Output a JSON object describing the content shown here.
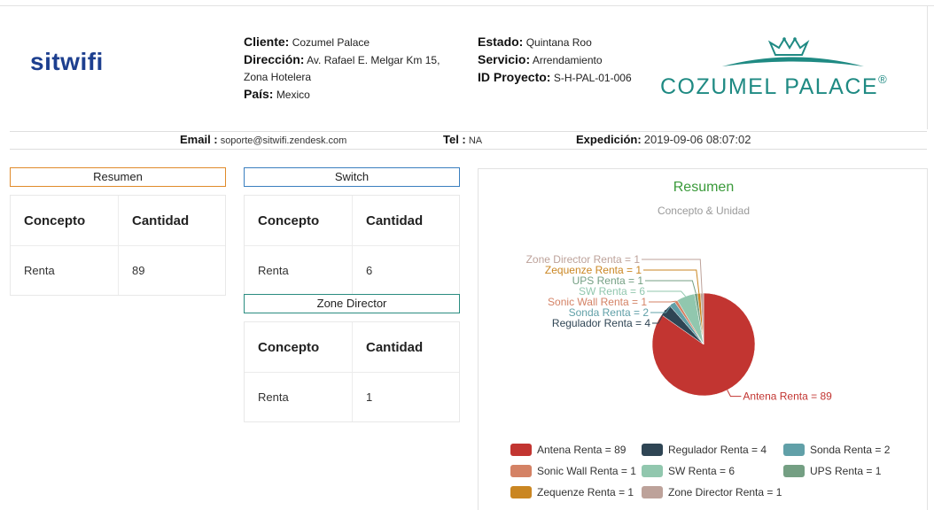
{
  "header": {
    "logo_text": "sitwifi",
    "brand_text": "COZUMEL PALACE",
    "brand_mark": "®",
    "cliente": {
      "label": "Cliente:",
      "value": "Cozumel Palace"
    },
    "direccion": {
      "label": "Dirección:",
      "value_line1": "Av. Rafael E. Melgar Km 15,",
      "value_line2": "Zona Hotelera"
    },
    "pais": {
      "label": "País:",
      "value": "Mexico"
    },
    "estado": {
      "label": "Estado:",
      "value": "Quintana Roo"
    },
    "servicio": {
      "label": "Servicio:",
      "value": "Arrendamiento"
    },
    "id_proyecto": {
      "label": "ID Proyecto:",
      "value": "S-H-PAL-01-006"
    }
  },
  "contact": {
    "email": {
      "label": "Email :",
      "value": "soporte@sitwifi.zendesk.com"
    },
    "tel": {
      "label": "Tel :",
      "value": "NA"
    },
    "expedicion": {
      "label": "Expedición:",
      "value": "2019-09-06 08:07:02"
    }
  },
  "panels": {
    "resumen": {
      "title": "Resumen",
      "headers": [
        "Concepto",
        "Cantidad"
      ],
      "rows": [
        [
          "Renta",
          "89"
        ]
      ]
    },
    "switch": {
      "title": "Switch",
      "headers": [
        "Concepto",
        "Cantidad"
      ],
      "rows": [
        [
          "Renta",
          "6"
        ]
      ]
    },
    "zone_director": {
      "title": "Zone Director",
      "headers": [
        "Concepto",
        "Cantidad"
      ],
      "rows": [
        [
          "Renta",
          "1"
        ]
      ]
    }
  },
  "chart_data": {
    "type": "pie",
    "title": "Resumen",
    "subtitle": "Concepto & Unidad",
    "legend_position": "bottom",
    "slices": [
      {
        "name": "Antena Renta",
        "value": 89,
        "color": "#c23531"
      },
      {
        "name": "Regulador Renta",
        "value": 4,
        "color": "#2f4554"
      },
      {
        "name": "Sonda Renta",
        "value": 2,
        "color": "#61a0a8"
      },
      {
        "name": "Sonic Wall Renta",
        "value": 1,
        "color": "#d48265"
      },
      {
        "name": "SW Renta",
        "value": 6,
        "color": "#91c7ae"
      },
      {
        "name": "UPS Renta",
        "value": 1,
        "color": "#749f83"
      },
      {
        "name": "Zequenze Renta",
        "value": 1,
        "color": "#ca8622"
      },
      {
        "name": "Zone Director Renta",
        "value": 1,
        "color": "#bda29a"
      }
    ]
  }
}
